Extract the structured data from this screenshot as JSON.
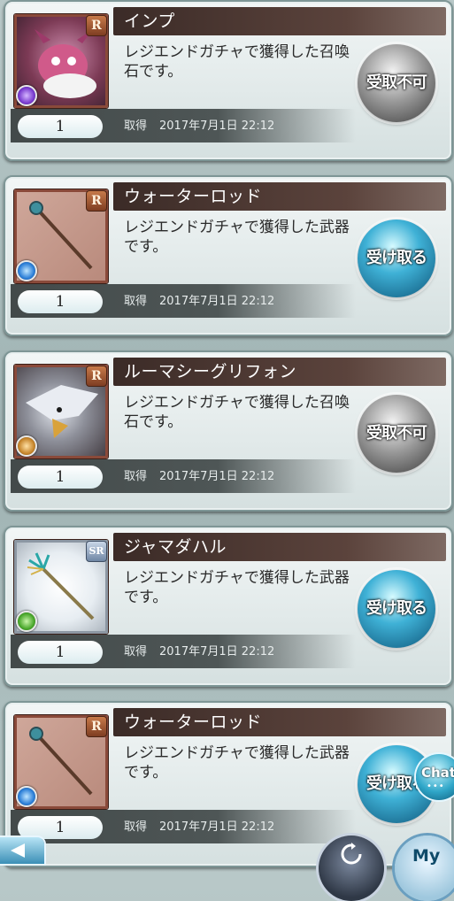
{
  "items": [
    {
      "name": "インプ",
      "rarity": "R",
      "element": "dark",
      "thumb": "imp-summon-art",
      "desc": "レジエンドガチャで獲得した召喚石です。",
      "qty": "1",
      "got_label": "取得",
      "date": "2017年7月1日 22:12",
      "action": "受取不可",
      "action_state": "disabled"
    },
    {
      "name": "ウォーターロッド",
      "rarity": "R",
      "element": "water",
      "thumb": "water-rod-staff-art",
      "desc": "レジエンドガチャで獲得した武器です。",
      "qty": "1",
      "got_label": "取得",
      "date": "2017年7月1日 22:12",
      "action": "受け取る",
      "action_state": "active"
    },
    {
      "name": "ルーマシーグリフォン",
      "rarity": "R",
      "element": "earth",
      "thumb": "griffon-summon-art",
      "desc": "レジエンドガチャで獲得した召喚石です。",
      "qty": "1",
      "got_label": "取得",
      "date": "2017年7月1日 22:12",
      "action": "受取不可",
      "action_state": "disabled"
    },
    {
      "name": "ジャマダハル",
      "rarity": "SR",
      "element": "wind",
      "thumb": "trident-weapon-art",
      "desc": "レジエンドガチャで獲得した武器です。",
      "qty": "1",
      "got_label": "取得",
      "date": "2017年7月1日 22:12",
      "action": "受け取る",
      "action_state": "active"
    },
    {
      "name": "ウォーターロッド",
      "rarity": "R",
      "element": "water",
      "thumb": "water-rod-staff-art",
      "desc": "レジエンドガチャで獲得した武器です。",
      "qty": "1",
      "got_label": "取得",
      "date": "2017年7月1日 22:12",
      "action": "受け取る",
      "action_state": "active"
    }
  ],
  "nav": {
    "back_icon": "back-arrow-icon",
    "reload_icon": "reload-icon",
    "my_label": "My",
    "chat_label": "Chat"
  }
}
